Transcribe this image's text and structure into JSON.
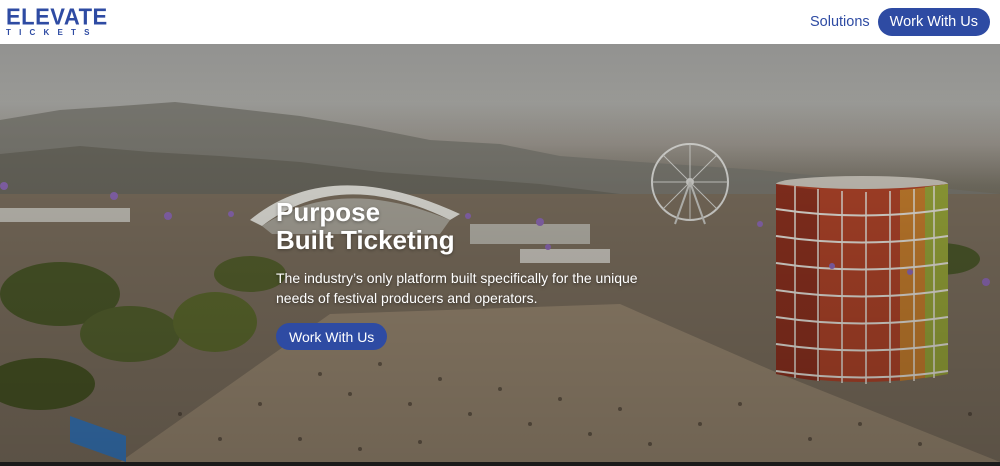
{
  "header": {
    "logo": {
      "main": "ELEVATE",
      "sub": "TICKETS"
    },
    "nav": {
      "solutions_label": "Solutions",
      "cta_label": "Work With Us"
    }
  },
  "hero": {
    "title_line1": "Purpose",
    "title_line2": "Built Ticketing",
    "description": "The industry’s only platform built specifically for the unique needs of festival producers and operators.",
    "cta_label": "Work With Us"
  },
  "colors": {
    "brand": "#2e4ba3",
    "header_bg": "#ffffff",
    "text_on_hero": "#ffffff"
  }
}
